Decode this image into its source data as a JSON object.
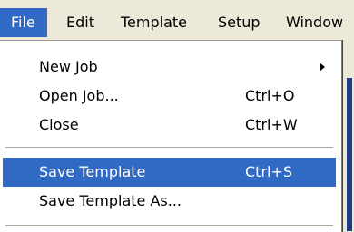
{
  "menubar": {
    "items": [
      {
        "label": "File"
      },
      {
        "label": "Edit"
      },
      {
        "label": "Template"
      },
      {
        "label": "Setup"
      },
      {
        "label": "Window"
      }
    ]
  },
  "file_menu": {
    "items": [
      {
        "label": "New Job",
        "shortcut": "",
        "submenu": true
      },
      {
        "label": "Open Job...",
        "shortcut": "Ctrl+O"
      },
      {
        "label": "Close",
        "shortcut": "Ctrl+W"
      },
      {
        "label": "Save Template",
        "shortcut": "Ctrl+S",
        "highlighted": true
      },
      {
        "label": "Save Template As...",
        "shortcut": ""
      }
    ]
  },
  "colors": {
    "highlight": "#316ac5",
    "menubar_bg": "#ece9d8",
    "menu_bg": "#ffffff"
  },
  "icons": [
    "submenu-arrow-icon"
  ]
}
